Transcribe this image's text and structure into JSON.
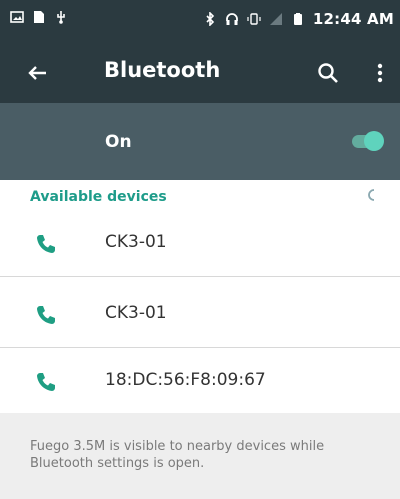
{
  "status_bar": {
    "time": "12:44 AM",
    "icons_left": [
      "image-icon",
      "sim-icon",
      "usb-icon"
    ],
    "icons_right": [
      "bluetooth-icon",
      "headset-icon",
      "vibrate-icon",
      "no-signal-icon",
      "battery-icon"
    ]
  },
  "app_bar": {
    "title": "Bluetooth"
  },
  "toggle": {
    "label": "On",
    "state": true
  },
  "section": {
    "title": "Available devices"
  },
  "devices": [
    {
      "name": "CK3-01"
    },
    {
      "name": "CK3-01"
    },
    {
      "name": "18:DC:56:F8:09:67"
    }
  ],
  "footer": {
    "text": "Fuego 3.5M is visible to nearby devices while Bluetooth settings is open."
  },
  "colors": {
    "appbar_bg": "#2b3a40",
    "toggle_bg": "#4a5d65",
    "accent": "#1e9c8a",
    "phone_icon": "#1f9e83"
  }
}
